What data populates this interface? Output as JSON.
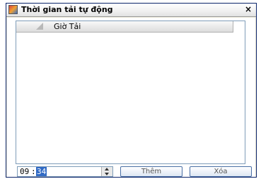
{
  "window": {
    "title": "Thời gian tải tự động",
    "close_label": "×"
  },
  "list": {
    "column_header": "Giờ Tải",
    "rows": []
  },
  "time_picker": {
    "hour": "09",
    "separator": ":",
    "minute": "34"
  },
  "buttons": {
    "add_label": "Thêm",
    "delete_label": "Xóa"
  },
  "icons": {
    "app": "app-icon",
    "close": "close-icon",
    "sort": "sort-indicator-icon",
    "spin_up": "chevron-up-icon",
    "spin_down": "chevron-down-icon"
  }
}
